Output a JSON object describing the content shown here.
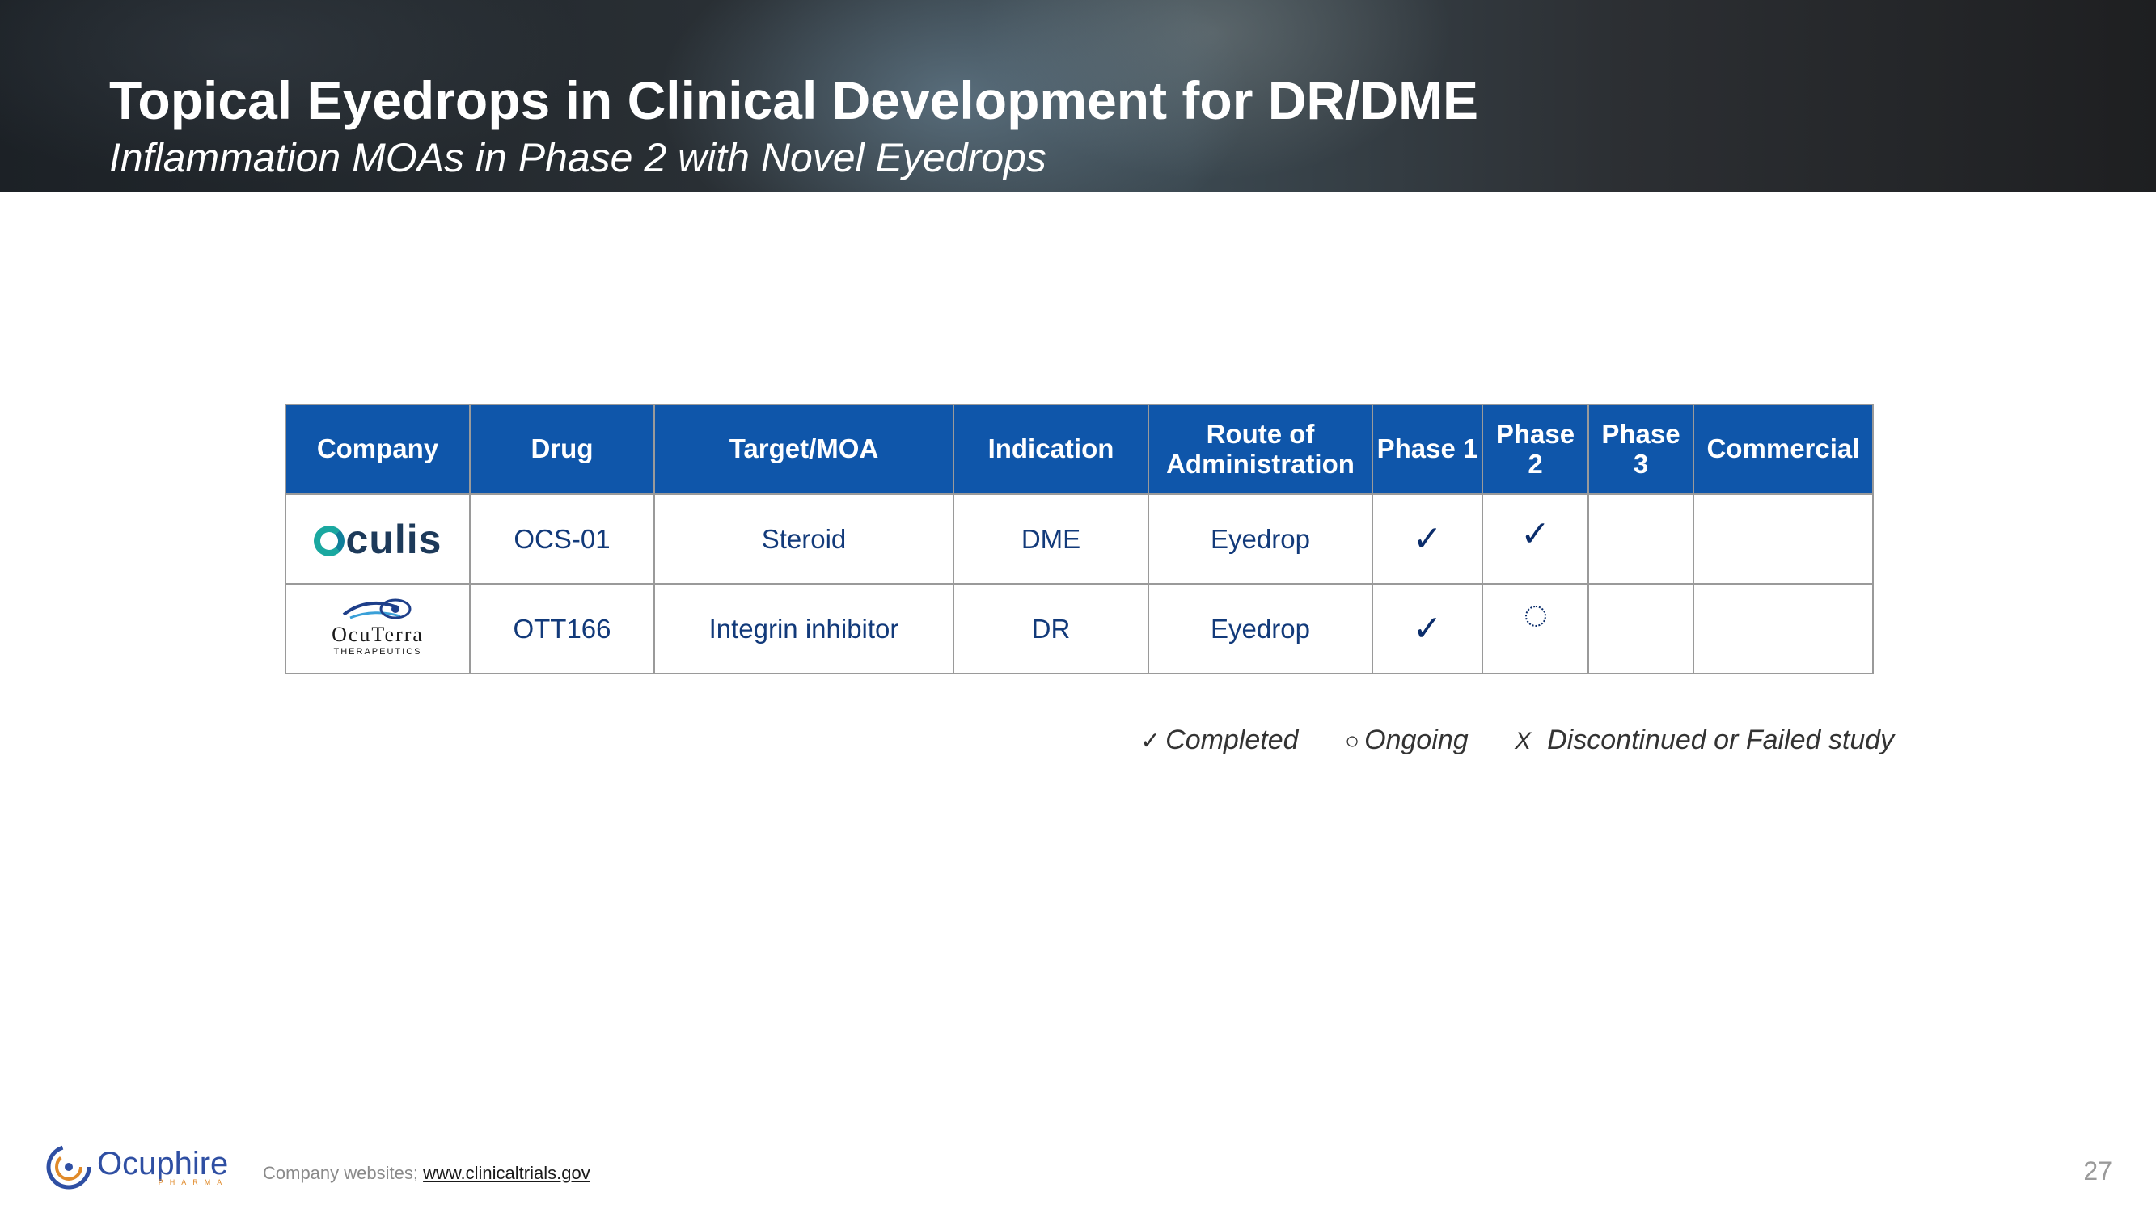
{
  "header": {
    "title": "Topical Eyedrops in Clinical Development for DR/DME",
    "subtitle": "Inflammation MOAs in Phase 2 with Novel Eyedrops"
  },
  "table": {
    "columns": [
      "Company",
      "Drug",
      "Target/MOA",
      "Indication",
      "Route of Administration",
      "Phase 1",
      "Phase 2",
      "Phase 3",
      "Commercial"
    ],
    "rows": [
      {
        "company_logo_text": "Oculis",
        "company_logo_icon": "oculis-logo",
        "drug": "OCS-01",
        "target": "Steroid",
        "indication": "DME",
        "route": "Eyedrop",
        "phase1": "completed",
        "phase2": "completed",
        "phase3": "",
        "commercial": ""
      },
      {
        "company_logo_text": "OCUTERRA",
        "company_logo_subtext": "THERAPEUTICS",
        "company_logo_icon": "ocuterra-logo",
        "drug": "OTT166",
        "target": "Integrin inhibitor",
        "indication": "DR",
        "route": "Eyedrop",
        "phase1": "completed",
        "phase2": "ongoing",
        "phase3": "",
        "commercial": ""
      }
    ]
  },
  "legend": {
    "completed_symbol": "✓",
    "completed": "Completed",
    "ongoing_symbol": "○",
    "ongoing": "Ongoing",
    "discontinued_symbol": "X",
    "discontinued": "Discontinued or Failed study"
  },
  "footer": {
    "logo_text": "Ocuphire",
    "logo_subtext": "PHARMA",
    "source_label": "Company websites; ",
    "source_link": "www.clinicaltrials.gov",
    "page_number": "27"
  },
  "colors": {
    "header_fill": "#0f56aa",
    "body_text": "#0b2d6b",
    "oculis_teal": "#1aa8a0",
    "ocuphire_blue": "#2f4fa3",
    "ocuphire_orange": "#e08a2a"
  }
}
